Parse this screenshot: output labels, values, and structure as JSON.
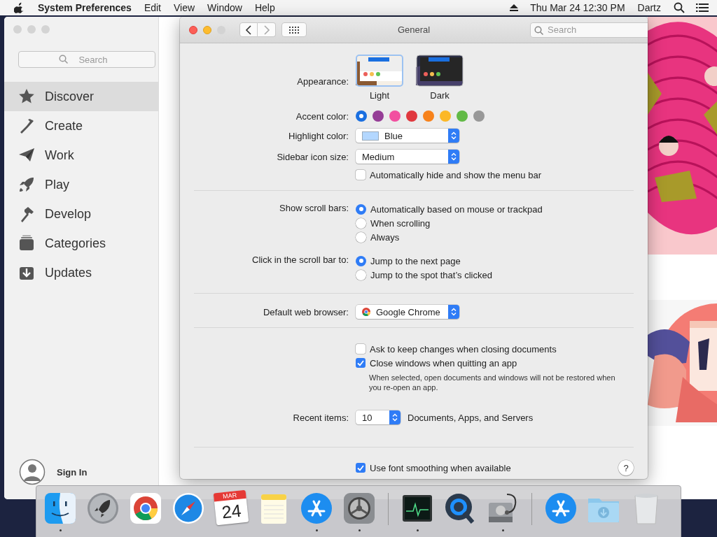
{
  "menu_bar": {
    "app_name": "System Preferences",
    "menus": [
      "Edit",
      "View",
      "Window",
      "Help"
    ],
    "clock": "Thu Mar 24  12:30 PM",
    "user": "Dartz"
  },
  "app_store": {
    "search": {
      "placeholder": "Search"
    },
    "sidebar": {
      "items": [
        {
          "kind": "star",
          "label": "Discover",
          "selected": true
        },
        {
          "kind": "brush",
          "label": "Create",
          "selected": false
        },
        {
          "kind": "plane",
          "label": "Work",
          "selected": false
        },
        {
          "kind": "rocket",
          "label": "Play",
          "selected": false
        },
        {
          "kind": "hammer",
          "label": "Develop",
          "selected": false
        },
        {
          "kind": "stack",
          "label": "Categories",
          "selected": false
        },
        {
          "kind": "download",
          "label": "Updates",
          "selected": false
        }
      ]
    },
    "sign_in": "Sign In"
  },
  "preferences": {
    "title": "General",
    "search": {
      "placeholder": "Search"
    },
    "appearance": {
      "label": "Appearance:",
      "options": [
        {
          "kind": "light",
          "label": "Light",
          "selected": true
        },
        {
          "kind": "dark",
          "label": "Dark",
          "selected": false
        }
      ]
    },
    "accent": {
      "label": "Accent color:",
      "colors": [
        {
          "color": "#1a6fe0",
          "selected": true
        },
        {
          "color": "#953d96",
          "selected": false
        },
        {
          "color": "#f24fa0",
          "selected": false
        },
        {
          "color": "#e0383e",
          "selected": false
        },
        {
          "color": "#f7821b",
          "selected": false
        },
        {
          "color": "#fcb827",
          "selected": false
        },
        {
          "color": "#62ba46",
          "selected": false
        },
        {
          "color": "#989898",
          "selected": false
        }
      ]
    },
    "highlight": {
      "label": "Highlight color:",
      "value": "Blue",
      "color": "#b3d7ff"
    },
    "sidebar_icon_size": {
      "label": "Sidebar icon size:",
      "value": "Medium"
    },
    "auto_hide_menu_bar": {
      "label": "Automatically hide and show the menu bar",
      "checked": false
    },
    "show_scroll_bars": {
      "label": "Show scroll bars:",
      "options": [
        {
          "label": "Automatically based on mouse or trackpad",
          "selected": true
        },
        {
          "label": "When scrolling",
          "selected": false
        },
        {
          "label": "Always",
          "selected": false
        }
      ]
    },
    "click_scroll_bar": {
      "label": "Click in the scroll bar to:",
      "options": [
        {
          "label": "Jump to the next page",
          "selected": true
        },
        {
          "label": "Jump to the spot that’s clicked",
          "selected": false
        }
      ]
    },
    "default_browser": {
      "label": "Default web browser:",
      "value": "Google Chrome"
    },
    "ask_keep_changes": {
      "label": "Ask to keep changes when closing documents",
      "checked": false
    },
    "close_windows": {
      "label": "Close windows when quitting an app",
      "checked": true,
      "note": "When selected, open documents and windows will not be restored when you re-open an app."
    },
    "recent_items": {
      "label": "Recent items:",
      "value": "10",
      "suffix": "Documents, Apps, and Servers"
    },
    "font_smoothing": {
      "label": "Use font smoothing when available",
      "checked": true
    },
    "help": "?"
  },
  "dock": {
    "items": [
      {
        "kind": "finder",
        "running": true
      },
      {
        "kind": "launchpad",
        "running": false
      },
      {
        "kind": "chrome",
        "running": false
      },
      {
        "kind": "safari",
        "running": false
      },
      {
        "kind": "calendar",
        "running": false,
        "month": "MAR",
        "day": "24"
      },
      {
        "kind": "notes",
        "running": false
      },
      {
        "kind": "appstore",
        "running": true
      },
      {
        "kind": "sysprefs",
        "running": true
      },
      {
        "kind": "separator"
      },
      {
        "kind": "activity",
        "running": true
      },
      {
        "kind": "quicktime",
        "running": false
      },
      {
        "kind": "diskutility",
        "running": true
      },
      {
        "kind": "separator"
      },
      {
        "kind": "appstore",
        "running": false
      },
      {
        "kind": "downloads",
        "running": false
      },
      {
        "kind": "trash",
        "running": false
      }
    ]
  }
}
